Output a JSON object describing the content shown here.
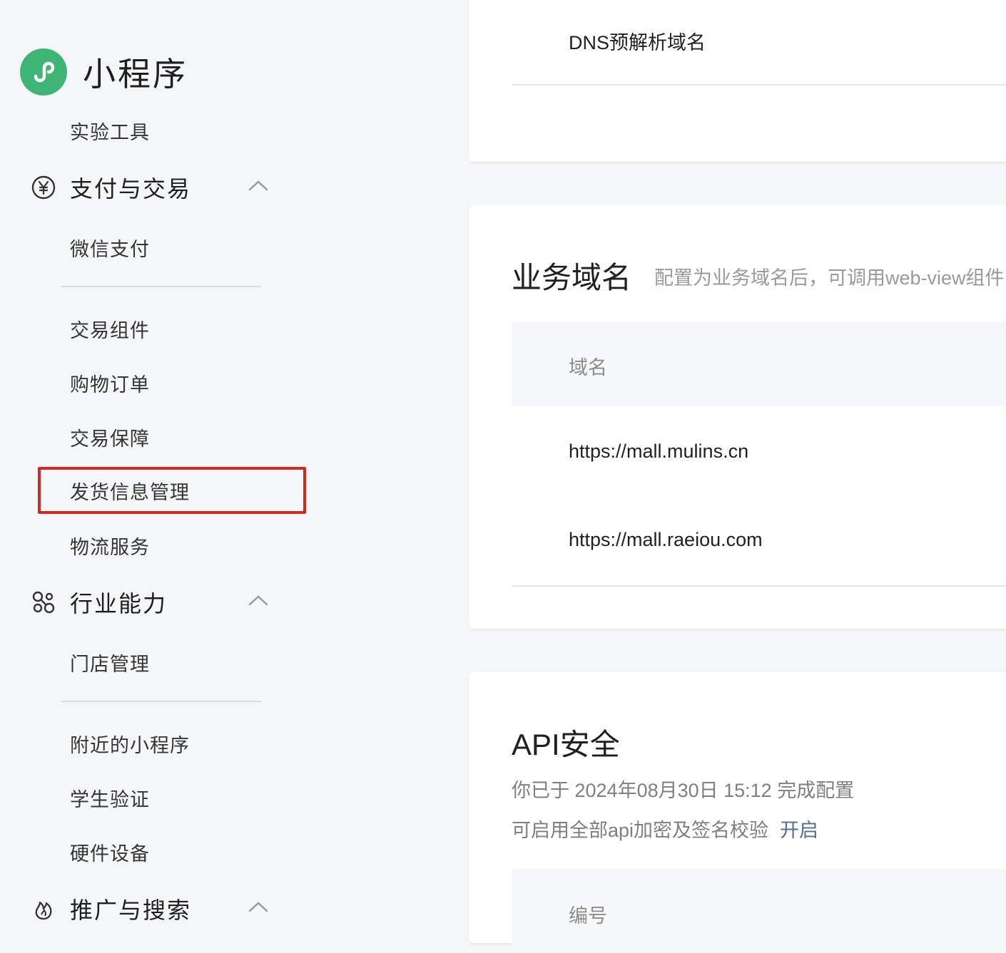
{
  "brand": {
    "title": "小程序",
    "logo_icon": "mini-program-logo",
    "logo_color": "#3eb575"
  },
  "sidebar": {
    "lab_tools": "实验工具",
    "groups": [
      {
        "label": "支付与交易",
        "icon": "yuan-circle-icon",
        "expanded": true,
        "items": [
          "微信支付",
          "交易组件",
          "购物订单",
          "交易保障",
          "发货信息管理",
          "物流服务"
        ]
      },
      {
        "label": "行业能力",
        "icon": "industry-nodes-icon",
        "expanded": true,
        "items": [
          "门店管理",
          "附近的小程序",
          "学生验证",
          "硬件设备"
        ]
      },
      {
        "label": "推广与搜索",
        "icon": "flame-icon",
        "expanded": true,
        "items": []
      }
    ],
    "highlighted_item": "发货信息管理",
    "highlight_color": "#cf2b23"
  },
  "dns_card": {
    "label": "DNS预解析域名"
  },
  "business_domain": {
    "title": "业务域名",
    "description": "配置为业务域名后，可调用web-view组件",
    "column_header": "域名",
    "domains": [
      "https://mall.mulins.cn",
      "https://mall.raeiou.com"
    ]
  },
  "api_security": {
    "title": "API安全",
    "configured_text": "你已于 2024年08月30日 15:12 完成配置",
    "enable_text": "可启用全部api加密及签名校验",
    "enable_link": "开启",
    "column_header": "编号",
    "link_color": "#576b95"
  }
}
